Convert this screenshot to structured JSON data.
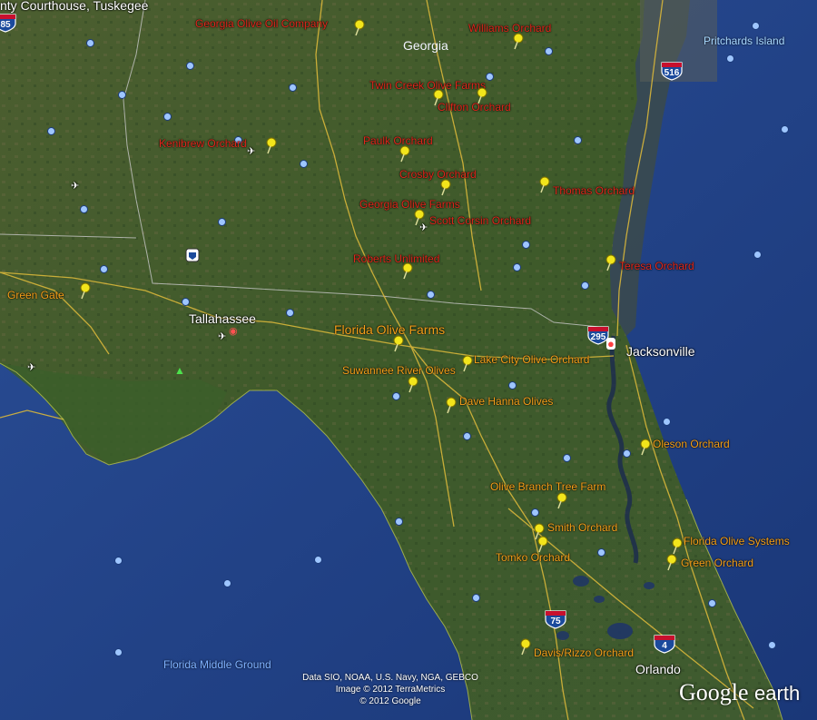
{
  "map": {
    "colors": {
      "ocean": "#1d3f86",
      "land": "#3d5a2b",
      "placemark_pin": "#f2e51b",
      "label_red": "#e0281c",
      "label_orange": "#f5a01a",
      "road": "#d8b63a"
    },
    "labels": {
      "top_left_city": "nty Courthouse, Tuskegee",
      "georgia": "Georgia",
      "pritchards": "Pritchards Island",
      "tallahassee": "Tallahassee",
      "jacksonville": "Jacksonville",
      "orlando": "Orlando",
      "florida_middle_ground": "Florida Middle Ground"
    },
    "highways": {
      "i85": "85",
      "i516": "516",
      "i295": "295",
      "i75": "75",
      "i4": "4"
    },
    "placemarks": [
      {
        "name": "Georgia Olive Oil Company",
        "color": "red"
      },
      {
        "name": "Williams Orchard",
        "color": "red"
      },
      {
        "name": "Twin Creek Olive Farms",
        "color": "red"
      },
      {
        "name": "Clifton Orchard",
        "color": "red"
      },
      {
        "name": "Kenibrew Orchard",
        "color": "red"
      },
      {
        "name": "Paulk Orchard",
        "color": "red"
      },
      {
        "name": "Crosby Orchard",
        "color": "red"
      },
      {
        "name": "Thomas Orchard",
        "color": "red"
      },
      {
        "name": "Georgia Olive Farms",
        "color": "red"
      },
      {
        "name": "Scott Corsin Orchard",
        "color": "red"
      },
      {
        "name": "Roberts Unlimited",
        "color": "red"
      },
      {
        "name": "Teresa Orchard",
        "color": "red"
      },
      {
        "name": "Green Gate",
        "color": "orange"
      },
      {
        "name": "Florida Olive Farms",
        "color": "orange"
      },
      {
        "name": "Lake City Olive Orchard",
        "color": "orange"
      },
      {
        "name": "Suwannee River Olives",
        "color": "orange"
      },
      {
        "name": "Dave Hanna Olives",
        "color": "orange"
      },
      {
        "name": "Oleson Orchard",
        "color": "orange"
      },
      {
        "name": "Olive Branch Tree Farm",
        "color": "orange"
      },
      {
        "name": "Smith Orchard",
        "color": "orange"
      },
      {
        "name": "Florida Olive Systems",
        "color": "orange"
      },
      {
        "name": "Tomko Orchard",
        "color": "orange"
      },
      {
        "name": "Green Orchard",
        "color": "orange"
      },
      {
        "name": "Davis/Rizzo Orchard",
        "color": "orange"
      }
    ],
    "credits": {
      "line1": "Data SIO, NOAA, U.S. Navy, NGA, GEBCO",
      "line2": "Image © 2012 TerraMetrics",
      "line3": "© 2012 Google"
    },
    "logo": {
      "google": "Google",
      "earth": "earth"
    }
  }
}
